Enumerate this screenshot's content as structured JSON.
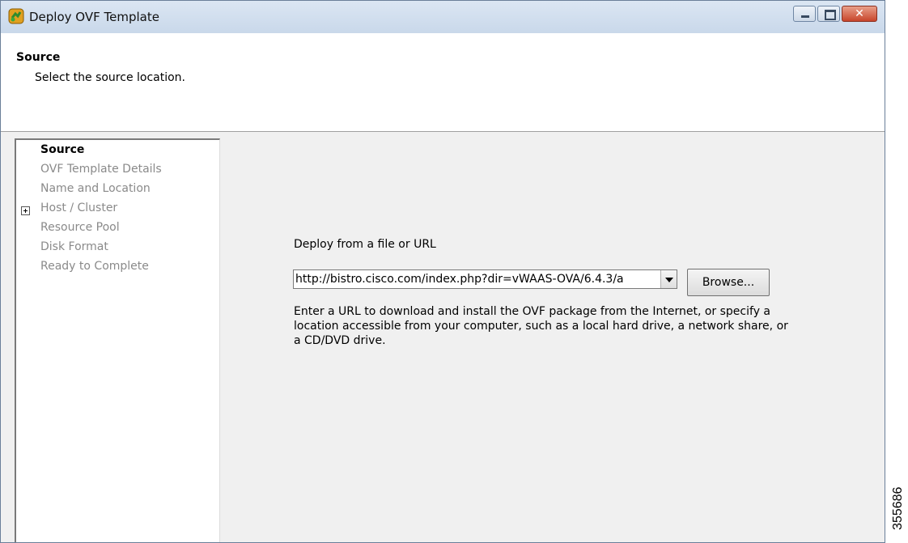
{
  "window": {
    "title": "Deploy OVF Template",
    "icon": "ovf-deploy-icon",
    "controls": [
      "minimize-icon",
      "maximize-icon",
      "close-icon"
    ]
  },
  "header": {
    "title": "Source",
    "subtitle": "Select the source location."
  },
  "nav": {
    "items": [
      {
        "label": "Source",
        "active": true
      },
      {
        "label": "OVF Template Details",
        "active": false
      },
      {
        "label": "Name and Location",
        "active": false
      },
      {
        "label": "Host / Cluster",
        "active": false,
        "expandable": true
      },
      {
        "label": "Resource Pool",
        "active": false
      },
      {
        "label": "Disk Format",
        "active": false
      },
      {
        "label": "Ready to Complete",
        "active": false
      }
    ]
  },
  "main": {
    "deploy_label": "Deploy from a file or URL",
    "url_value": "http://bistro.cisco.com/index.php?dir=vWAAS-OVA/6.4.3/a",
    "browse_label": "Browse...",
    "help_text": "Enter a URL to download and install the OVF package from the Internet, or specify a location accessible from your computer, such as a local hard drive, a network share, or a CD/DVD drive."
  },
  "figure_id": "355686",
  "colors": {
    "title_bar": "#c9d8ea",
    "body_bg": "#f0f0f0",
    "close_button": "#c8452b",
    "inactive_nav_text": "#8a8a8a"
  }
}
